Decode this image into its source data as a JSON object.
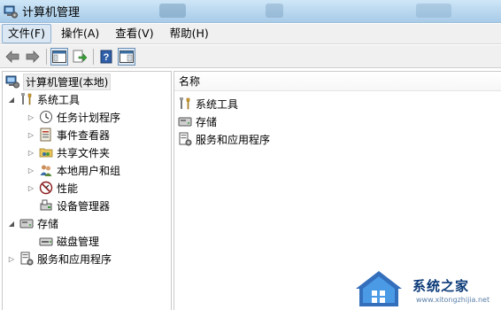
{
  "window": {
    "title": "计算机管理"
  },
  "menu": {
    "file": "文件(F)",
    "action": "操作(A)",
    "view": "查看(V)",
    "help": "帮助(H)"
  },
  "toolbar": {
    "icons": [
      "back-arrow-icon",
      "forward-arrow-icon",
      "console-tree-icon",
      "export-list-icon",
      "help-icon",
      "show-hide-pane-icon"
    ]
  },
  "tree": {
    "root": "计算机管理(本地)",
    "system_tools": "系统工具",
    "task_scheduler": "任务计划程序",
    "event_viewer": "事件查看器",
    "shared_folders": "共享文件夹",
    "local_users": "本地用户和组",
    "performance": "性能",
    "device_manager": "设备管理器",
    "storage": "存储",
    "disk_management": "磁盘管理",
    "services_apps": "服务和应用程序"
  },
  "list": {
    "column_name": "名称",
    "items": [
      "系统工具",
      "存储",
      "服务和应用程序"
    ]
  },
  "watermark": {
    "text": "系统之家",
    "url": "www.xitongzhijia.net"
  },
  "colors": {
    "title_bar": "#bcd9f0",
    "menu_bg": "#f0f0f0",
    "selection": "#dbe8f4"
  }
}
